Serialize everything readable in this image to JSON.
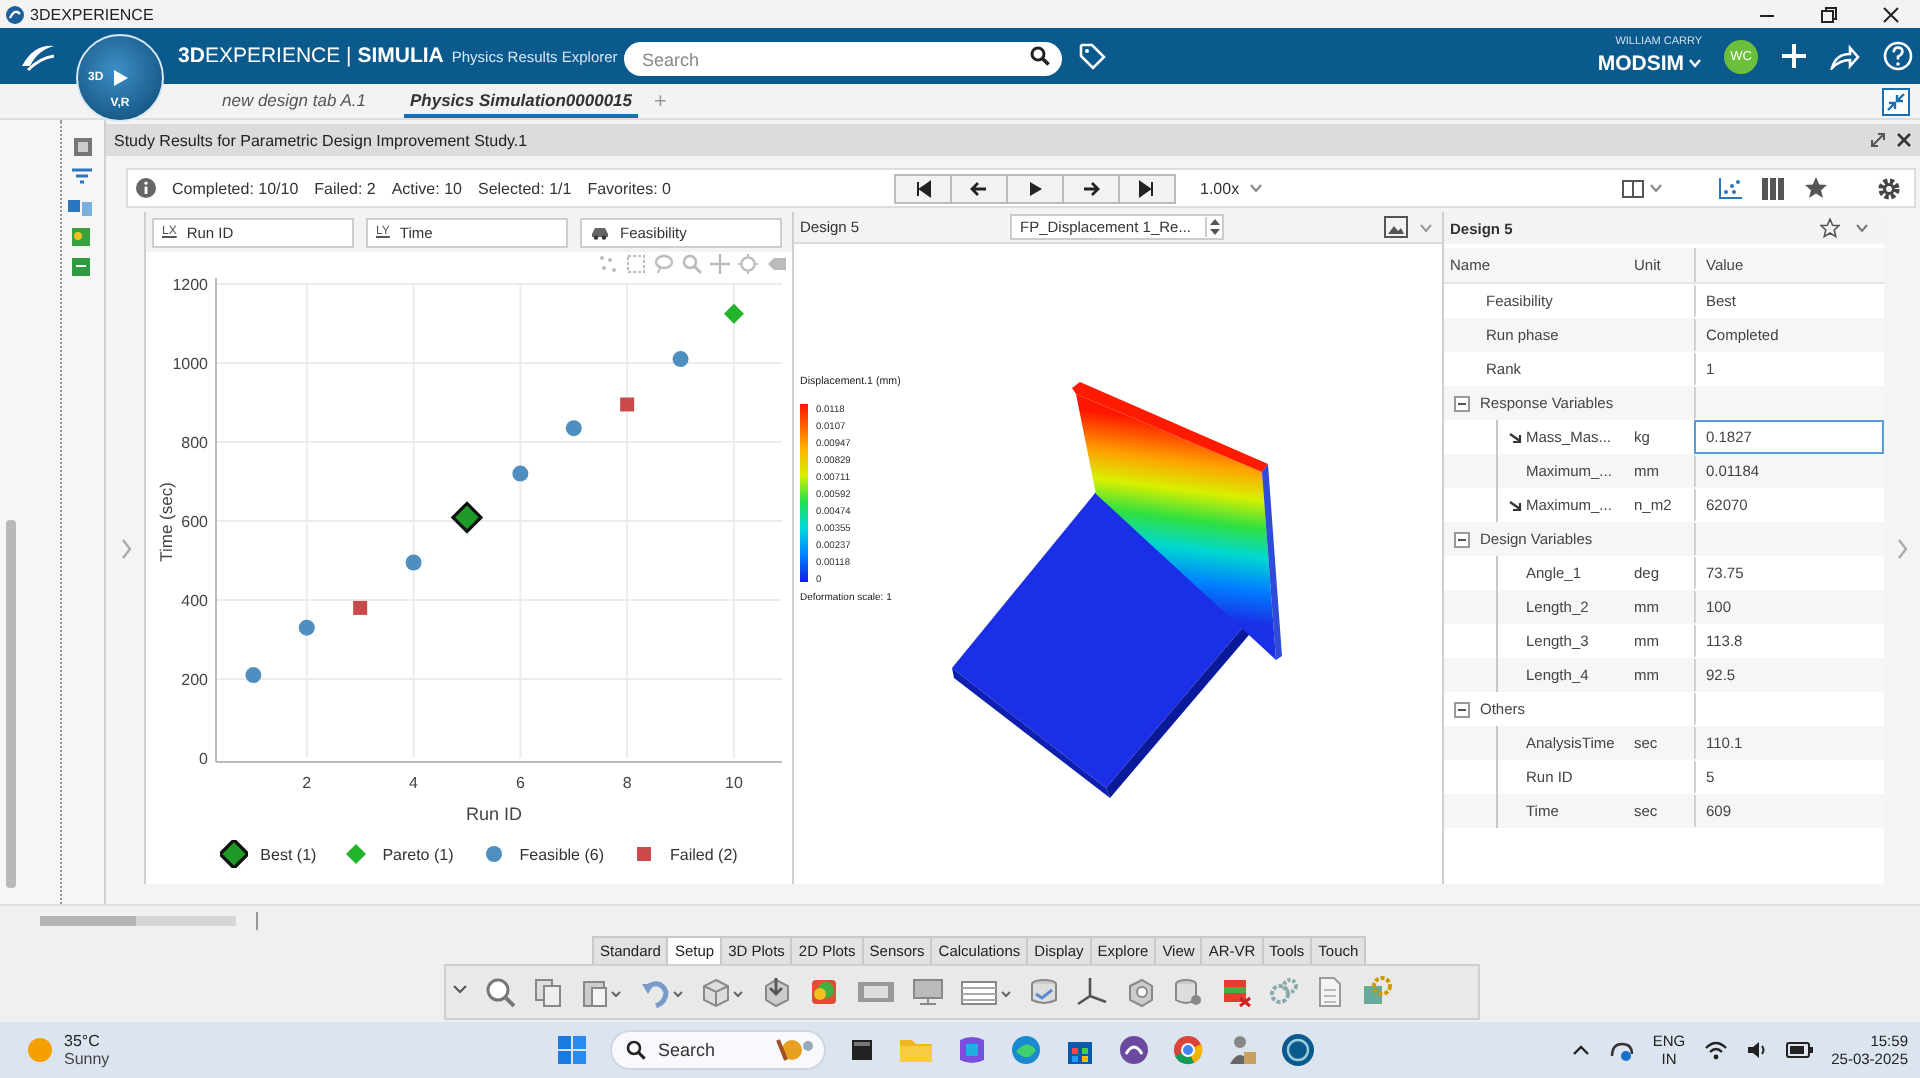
{
  "window": {
    "title": "3DEXPERIENCE"
  },
  "header": {
    "compass": {
      "left": "3D",
      "bottom": "V,R"
    },
    "brand": "**3D**EXPERIENCE | **SIMULIA**",
    "app": "Physics Results Explorer",
    "search": {
      "placeholder": "Search"
    },
    "user": {
      "name": "WILLIAM CARRY",
      "tenant": "MODSIM",
      "initials": "WC"
    }
  },
  "tabs": [
    {
      "label": "new design tab A.1",
      "selected": false
    },
    {
      "label": "Physics Simulation0000015",
      "selected": true
    }
  ],
  "add_tab": "+",
  "panel": {
    "title": "Study Results for Parametric Design Improvement Study.1",
    "status": [
      "Completed: 10/10",
      "Failed: 2",
      "Active: 10",
      "Selected: 1/1",
      "Favorites: 0"
    ],
    "speed": "1.00x",
    "chart_pane": {
      "fields": [
        {
          "kind": "x",
          "glyph": "LX",
          "value": "Run ID"
        },
        {
          "kind": "y",
          "glyph": "LY",
          "value": "Time"
        },
        {
          "kind": "color",
          "value": "Feasibility"
        }
      ],
      "chart_data": {
        "type": "scatter",
        "xlabel": "Run ID",
        "ylabel": "Time (sec)",
        "x": [
          1,
          2,
          3,
          4,
          5,
          6,
          7,
          8,
          9,
          10
        ],
        "series": [
          {
            "name": "Best (1)",
            "color": "#1f9a2a",
            "marker": "diamond-outlined",
            "values": [
              null,
              null,
              null,
              null,
              609,
              null,
              null,
              null,
              null,
              null
            ]
          },
          {
            "name": "Pareto (1)",
            "color": "#22b42a",
            "marker": "diamond",
            "values": [
              null,
              null,
              null,
              null,
              null,
              null,
              null,
              null,
              null,
              1125
            ]
          },
          {
            "name": "Feasible (6)",
            "color": "#4f8fc0",
            "marker": "circle",
            "values": [
              210,
              330,
              null,
              495,
              null,
              720,
              835,
              null,
              1010,
              null
            ]
          },
          {
            "name": "Failed (2)",
            "color": "#c94a4a",
            "marker": "square",
            "values": [
              null,
              null,
              380,
              null,
              null,
              null,
              null,
              895,
              null,
              null
            ]
          }
        ],
        "grid": true,
        "legend": true,
        "xlim": [
          0.3,
          10.9
        ],
        "ylim": [
          0,
          1200
        ],
        "xticks": [
          2,
          4,
          6,
          8,
          10
        ],
        "yticks": [
          0,
          200,
          400,
          600,
          800,
          1000,
          1200
        ]
      }
    },
    "viewer": {
      "title": "Design 5",
      "result": "FP_Displacement 1_Re...",
      "legend": {
        "title": "Displacement.1 (mm)",
        "values": [
          "0.0118",
          "0.0107",
          "0.00947",
          "0.00829",
          "0.00711",
          "0.00592",
          "0.00474",
          "0.00355",
          "0.00237",
          "0.00118",
          "0"
        ],
        "footer": "Deformation scale: 1"
      }
    },
    "details": {
      "title": "Design 5",
      "columns": [
        "Name",
        "Unit",
        "Value"
      ],
      "rows": [
        {
          "name": "Feasibility",
          "value": "Best",
          "selected": false
        },
        {
          "name": "Run phase",
          "value": "Completed",
          "selected": false
        },
        {
          "name": "Rank",
          "value": "1",
          "selected": false
        },
        {
          "name": "Response Variables",
          "expanded": true,
          "selected": false,
          "children": [
            {
              "name": "Mass_Mas...",
              "unit": "kg",
              "value": "0.1827",
              "marked": true,
              "selected": true
            },
            {
              "name": "Maximum_...",
              "unit": "mm",
              "value": "0.01184",
              "marked": false,
              "selected": false
            },
            {
              "name": "Maximum_...",
              "unit": "n_m2",
              "value": "62070",
              "marked": true,
              "selected": false
            }
          ]
        },
        {
          "name": "Design Variables",
          "expanded": true,
          "selected": false,
          "children": [
            {
              "name": "Angle_1",
              "unit": "deg",
              "value": "73.75",
              "marked": false,
              "selected": false
            },
            {
              "name": "Length_2",
              "unit": "mm",
              "value": "100",
              "marked": false,
              "selected": false
            },
            {
              "name": "Length_3",
              "unit": "mm",
              "value": "113.8",
              "marked": false,
              "selected": false
            },
            {
              "name": "Length_4",
              "unit": "mm",
              "value": "92.5",
              "marked": false,
              "selected": false
            }
          ]
        },
        {
          "name": "Others",
          "expanded": true,
          "selected": false,
          "children": [
            {
              "name": "AnalysisTime",
              "unit": "sec",
              "value": "110.1",
              "marked": false,
              "selected": false
            },
            {
              "name": "Run ID",
              "value": "5",
              "marked": false,
              "selected": false
            },
            {
              "name": "Time",
              "unit": "sec",
              "value": "609",
              "marked": false,
              "selected": false
            }
          ]
        }
      ]
    }
  },
  "ribbon": {
    "tabs": [
      {
        "label": "Standard",
        "selected": false
      },
      {
        "label": "Setup",
        "selected": true
      },
      {
        "label": "3D Plots",
        "selected": false
      },
      {
        "label": "2D Plots",
        "selected": false
      },
      {
        "label": "Sensors",
        "selected": false
      },
      {
        "label": "Calculations",
        "selected": false
      },
      {
        "label": "Display",
        "selected": false
      },
      {
        "label": "Explore",
        "selected": false
      },
      {
        "label": "View",
        "selected": false
      },
      {
        "label": "AR-VR",
        "selected": false
      },
      {
        "label": "Tools",
        "selected": false
      },
      {
        "label": "Touch",
        "selected": false
      }
    ]
  },
  "taskbar": {
    "weather": {
      "temp": "35°C",
      "text": "Sunny"
    },
    "search": {
      "placeholder": "Search"
    },
    "language": [
      "ENG",
      "IN"
    ],
    "time": "15:59",
    "date": "25-03-2025"
  }
}
